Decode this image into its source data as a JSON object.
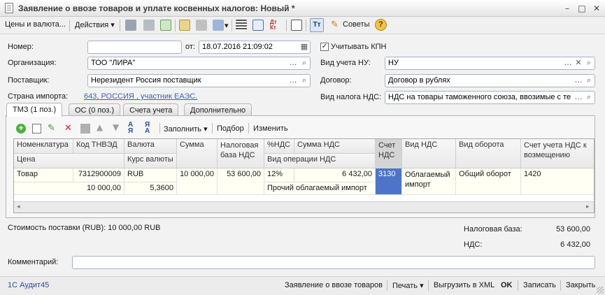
{
  "window": {
    "title": "Заявление о ввозе товаров и уплате косвенных налогов: Новый *",
    "controls": [
      "–",
      "□",
      "✕"
    ]
  },
  "toolbar": {
    "prices_currency": "Цены и валюта...",
    "actions": "Действия",
    "advice": "Советы",
    "help": "?"
  },
  "form": {
    "number_label": "Номер:",
    "number_value": "",
    "from_label": "от:",
    "date_value": "18.07.2016 21:09:02",
    "kpn_label": "Учитывать КПН",
    "kpn_checked": true,
    "org_label": "Организация:",
    "org_value": "ТОО \"ЛИРА\"",
    "nu_label": "Вид учета НУ:",
    "nu_value": "НУ",
    "supplier_label": "Поставщик:",
    "supplier_value": "Нерезидент Россия поставщик",
    "contract_label": "Договор:",
    "contract_value": "Договор в рублях",
    "country_label": "Страна импорта:",
    "country_value": "643, РОССИЯ , участник ЕАЭС.",
    "vat_type_label": "Вид налога НДС:",
    "vat_type_value": "НДС на товары таможенного союза, ввозимые с те"
  },
  "tabs": [
    {
      "label": "ТМЗ (1 поз.)",
      "active": true
    },
    {
      "label": "ОС (0 поз.)",
      "active": false
    },
    {
      "label": "Счета учета",
      "active": false
    },
    {
      "label": "Дополнительно",
      "active": false
    }
  ],
  "table_toolbar": {
    "fill": "Заполнить",
    "pick": "Подбор",
    "change": "Изменить"
  },
  "table": {
    "headers_top": [
      "Номенклатура",
      "Код ТНВЭД",
      "Валюта",
      "Сумма",
      "Налоговая база НДС",
      "%НДС",
      "Сумма НДС",
      "Счет НДС",
      "Вид НДС",
      "Вид оборота",
      "Счет учета НДС к возмещению"
    ],
    "headers_bottom": [
      "Цена",
      "Курс валюты",
      "Вид операции НДС"
    ],
    "row": {
      "item": "Товар",
      "tnved": "7312900009",
      "currency": "RUB",
      "sum": "10 000,00",
      "tax_base": "53 600,00",
      "vat_pct": "12%",
      "vat_sum": "6 432,00",
      "vat_account": "3130",
      "vat_kind": "Облагаемый импорт",
      "turnover": "Общий оборот",
      "refund_account": "1420",
      "price": "10 000,00",
      "rate": "5,3600",
      "operation": "Прочий облагаемый импорт"
    }
  },
  "totals": {
    "supply_cost": "Стоимость поставки (RUB): 10 000,00 RUB",
    "tax_base_label": "Налоговая база:",
    "tax_base_value": "53 600,00",
    "vat_label": "НДС:",
    "vat_value": "6 432,00"
  },
  "comment": {
    "label": "Комментарий:",
    "value": ""
  },
  "statusbar": {
    "app": "1С Аудит45",
    "statement": "Заявление о ввозе товаров",
    "print": "Печать",
    "export": "Выгрузить в XML",
    "ok": "OK",
    "save": "Записать",
    "close": "Закрыть"
  },
  "colors": {
    "link": "#3b63b0",
    "selected_cell": "#4d74c8",
    "active_tab": "#ffffff"
  }
}
